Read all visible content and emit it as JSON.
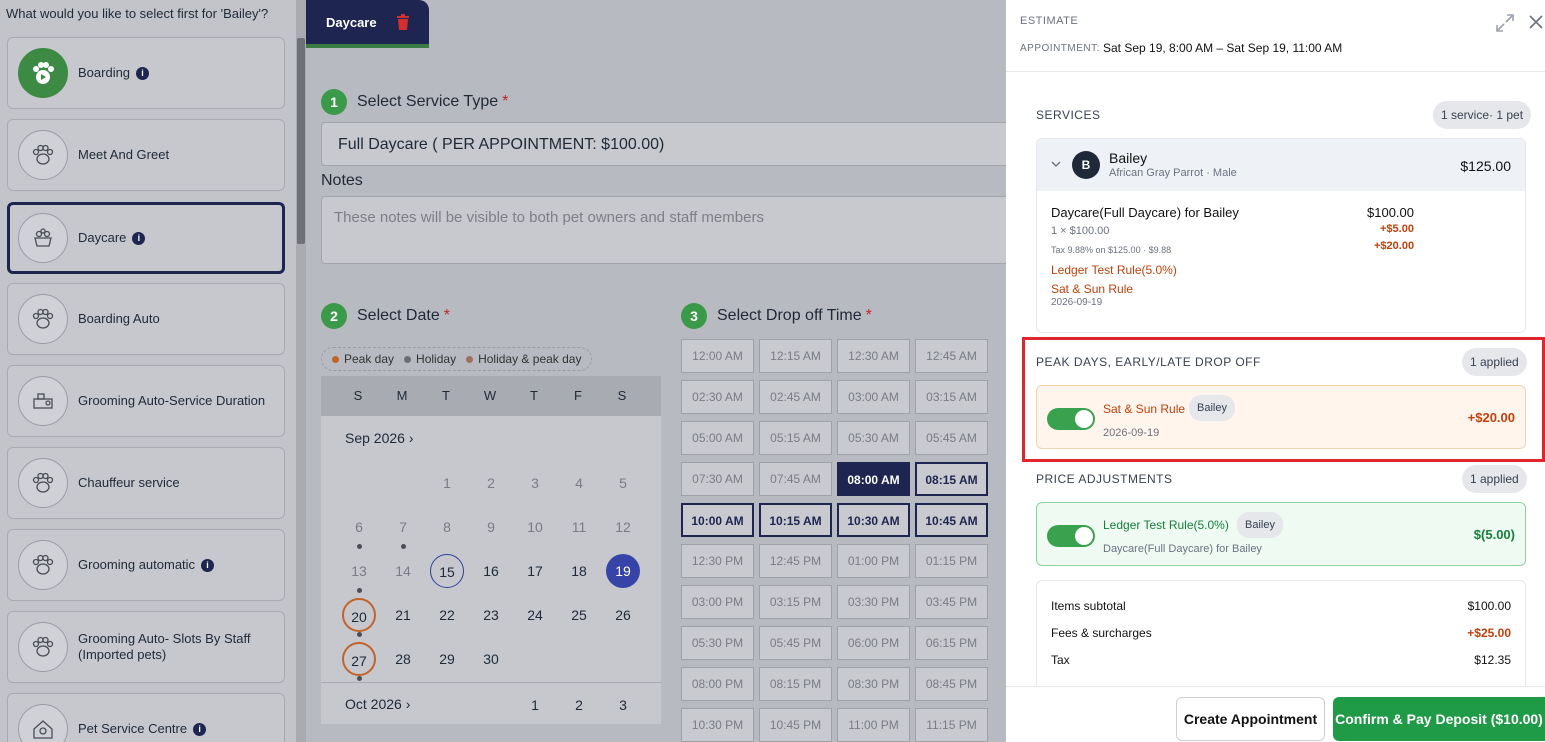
{
  "left": {
    "question": "What would you like to select first for 'Bailey'?",
    "services": [
      {
        "label": "Boarding",
        "icon": "paw-play-icon",
        "info": true
      },
      {
        "label": "Meet And Greet",
        "icon": "paw-icon",
        "info": false
      },
      {
        "label": "Daycare",
        "icon": "daycare-basket-icon",
        "info": true,
        "selected": true
      },
      {
        "label": "Boarding Auto",
        "icon": "paw-icon",
        "info": false
      },
      {
        "label": "Grooming Auto-Service Duration",
        "icon": "grooming-icon",
        "info": false
      },
      {
        "label": "Chauffeur service",
        "icon": "paw-icon",
        "info": false
      },
      {
        "label": "Grooming automatic",
        "icon": "paw-icon",
        "info": true
      },
      {
        "label": "Grooming Auto- Slots By Staff (Imported pets)",
        "icon": "paw-icon",
        "info": false
      },
      {
        "label": "Pet Service Centre",
        "icon": "pet-house-icon",
        "info": true
      }
    ]
  },
  "tab": {
    "label": "Daycare"
  },
  "step1": {
    "num": "1",
    "title": "Select Service Type",
    "value": "Full Daycare ( PER APPOINTMENT: $100.00)"
  },
  "notes": {
    "label": "Notes",
    "placeholder": "These notes will be visible to both pet owners and staff members"
  },
  "step2": {
    "num": "2",
    "title": "Select Date"
  },
  "legend": {
    "peak": "Peak day",
    "holiday": "Holiday",
    "both": "Holiday & peak day"
  },
  "calendar": {
    "weekdays": [
      "S",
      "M",
      "T",
      "W",
      "T",
      "F",
      "S"
    ],
    "month1": "Sep 2026",
    "month2": "Oct 2026",
    "oct_days": [
      "1",
      "2",
      "3"
    ]
  },
  "step3": {
    "num": "3",
    "title": "Select Drop off Time"
  },
  "times": [
    [
      "12:00 AM",
      "12:15 AM",
      "12:30 AM",
      "12:45 AM"
    ],
    [
      "02:30 AM",
      "02:45 AM",
      "03:00 AM",
      "03:15 AM"
    ],
    [
      "05:00 AM",
      "05:15 AM",
      "05:30 AM",
      "05:45 AM"
    ],
    [
      "07:30 AM",
      "07:45 AM",
      "08:00 AM",
      "08:15 AM"
    ],
    [
      "10:00 AM",
      "10:15 AM",
      "10:30 AM",
      "10:45 AM"
    ],
    [
      "12:30 PM",
      "12:45 PM",
      "01:00 PM",
      "01:15 PM"
    ],
    [
      "03:00 PM",
      "03:15 PM",
      "03:30 PM",
      "03:45 PM"
    ],
    [
      "05:30 PM",
      "05:45 PM",
      "06:00 PM",
      "06:15 PM"
    ],
    [
      "08:00 PM",
      "08:15 PM",
      "08:30 PM",
      "08:45 PM"
    ],
    [
      "10:30 PM",
      "10:45 PM",
      "11:00 PM",
      "11:15 PM"
    ]
  ],
  "estimate": {
    "title": "ESTIMATE",
    "appt_label": "APPOINTMENT:",
    "appt_value": "Sat Sep 19, 8:00 AM – Sat Sep 19, 11:00 AM",
    "services_title": "SERVICES",
    "services_badge": "1 service· 1 pet",
    "pet": {
      "initial": "B",
      "name": "Bailey",
      "desc": "African Gray Parrot · Male",
      "total": "$125.00"
    },
    "line_title": "Daycare(Full Daycare) for Bailey",
    "line_price": "$100.00",
    "line_qty": "1 × $100.00",
    "line_fee1": "+$5.00",
    "line_fee2": "+$20.00",
    "line_tax": "Tax 9.88% on $125.00 · $9.88",
    "rule1": "Ledger Test Rule(5.0%)",
    "rule2": "Sat & Sun Rule",
    "rule_date": "2026-09-19",
    "peak_title": "PEAK DAYS, EARLY/LATE DROP OFF",
    "peak_badge": "1 applied",
    "peak_rule": "Sat & Sun Rule",
    "peak_pet": "Bailey",
    "peak_date": "2026-09-19",
    "peak_amount": "+$20.00",
    "adj_title": "PRICE ADJUSTMENTS",
    "adj_badge": "1 applied",
    "adj_rule": "Ledger Test Rule(5.0%)",
    "adj_pet": "Bailey",
    "adj_desc": "Daycare(Full Daycare) for Bailey",
    "adj_amount": "$(5.00)",
    "subtotal_label": "Items subtotal",
    "subtotal": "$100.00",
    "fees_label": "Fees & surcharges",
    "fees": "+$25.00",
    "tax_label": "Tax",
    "tax": "$12.35",
    "create_btn": "Create Appointment",
    "confirm_btn": "Confirm & Pay Deposit ($10.00)"
  },
  "colors": {
    "navy": "#1d2550",
    "green": "#3a9a4a",
    "peak_orange": "#c2632a",
    "fee_red": "#c2410c",
    "highlight_red": "#e0252f"
  }
}
